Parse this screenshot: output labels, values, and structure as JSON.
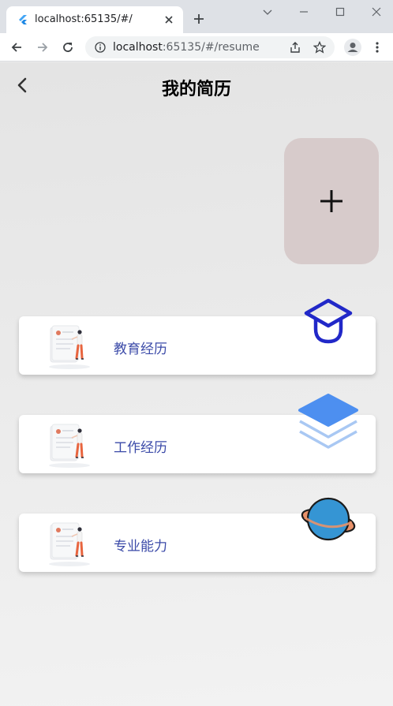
{
  "browser": {
    "tab_title": "localhost:65135/#/",
    "url_host": "localhost",
    "url_path": ":65135/#/resume"
  },
  "app": {
    "title": "我的简历",
    "add_symbol": "+",
    "sections": [
      {
        "label": "教育经历",
        "icon": "graduation-cap-icon"
      },
      {
        "label": "工作经历",
        "icon": "layers-icon"
      },
      {
        "label": "专业能力",
        "icon": "planet-icon"
      }
    ]
  },
  "colors": {
    "accent_text": "#3b4aa8",
    "add_button_bg": "#d7cbcb",
    "cap_icon": "#2128c8",
    "layers_icon": "#4d8ff0",
    "planet_icon": "#3595d4"
  }
}
